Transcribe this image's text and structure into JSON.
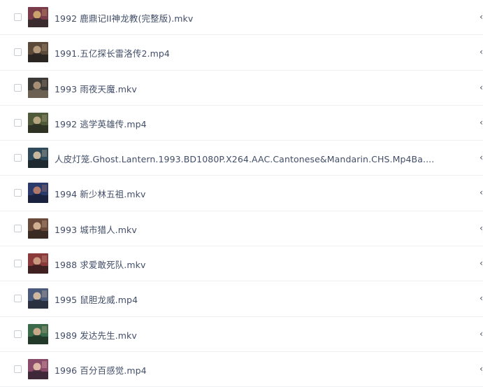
{
  "files": [
    {
      "name": "1992 鹿鼎记II神龙教(完整版).mkv",
      "trail": "‹",
      "colors": [
        "#7a3b4a",
        "#c9a36b",
        "#3a2b2e"
      ]
    },
    {
      "name": "1991.五亿探长雷洛传2.mp4",
      "trail": "‹",
      "colors": [
        "#5b4a3a",
        "#b59a7c",
        "#2b2622"
      ]
    },
    {
      "name": "1993 雨夜天魔.mkv",
      "trail": "‹",
      "colors": [
        "#3c3a36",
        "#a68f76",
        "#6b6052"
      ]
    },
    {
      "name": "1992 逃学英雄传.mp4",
      "trail": "‹",
      "colors": [
        "#4f5a3a",
        "#b8a680",
        "#2e3324"
      ]
    },
    {
      "name": "人皮灯笼.Ghost.Lantern.1993.BD1080P.X264.AAC.Cantonese&Mandarin.CHS.Mp4Ba....",
      "trail": "‹",
      "colors": [
        "#2f4a5a",
        "#c8b8a0",
        "#1f2a30"
      ]
    },
    {
      "name": "1994 新少林五祖.mkv",
      "trail": "‹",
      "colors": [
        "#2a3a6a",
        "#b07a6a",
        "#1a2240"
      ]
    },
    {
      "name": "1993 城市猎人.mkv",
      "trail": "‹",
      "colors": [
        "#6a4a3a",
        "#d0b090",
        "#3a2a22"
      ]
    },
    {
      "name": "1988 求爱敢死队.mkv",
      "trail": "‹",
      "colors": [
        "#8a3a3a",
        "#c99a80",
        "#402020"
      ]
    },
    {
      "name": "1995 鼠胆龙威.mp4",
      "trail": "‹",
      "colors": [
        "#4a5a7a",
        "#d0b8a0",
        "#2a3040"
      ]
    },
    {
      "name": "1989 发达先生.mkv",
      "trail": "‹",
      "colors": [
        "#3a6a4a",
        "#c8a888",
        "#223828"
      ]
    },
    {
      "name": "1996 百分百感觉.mp4",
      "trail": "‹",
      "colors": [
        "#8a4a6a",
        "#e0b8a8",
        "#402838"
      ]
    }
  ]
}
